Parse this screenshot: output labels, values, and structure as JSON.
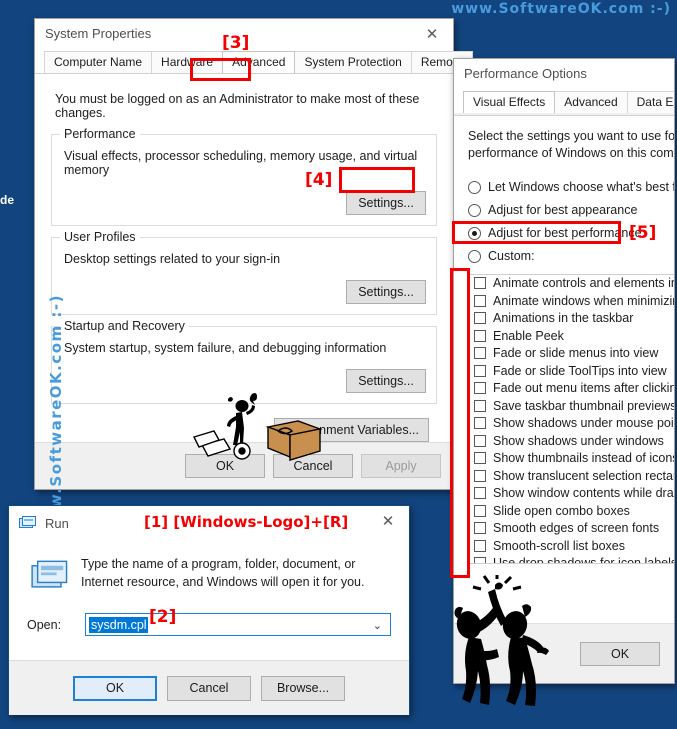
{
  "watermark": {
    "top": "www.SoftwareOK.com  :-)",
    "vertical": "www.SoftwareOK.com  :-)",
    "fragment": "de"
  },
  "system_properties": {
    "title": "System Properties",
    "close_icon": "✕",
    "tabs": [
      {
        "label": "Computer Name",
        "active": false
      },
      {
        "label": "Hardware",
        "active": false
      },
      {
        "label": "Advanced",
        "active": true
      },
      {
        "label": "System Protection",
        "active": false
      },
      {
        "label": "Remote",
        "active": false
      }
    ],
    "intro": "You must be logged on as an Administrator to make most of these changes.",
    "groups": [
      {
        "legend": "Performance",
        "text": "Visual effects, processor scheduling, memory usage, and virtual memory",
        "button": "Settings..."
      },
      {
        "legend": "User Profiles",
        "text": "Desktop settings related to your sign-in",
        "button": "Settings..."
      },
      {
        "legend": "Startup and Recovery",
        "text": "System startup, system failure, and debugging information",
        "button": "Settings..."
      }
    ],
    "environment_button": "Environment Variables...",
    "footer": {
      "ok": "OK",
      "cancel": "Cancel",
      "apply": "Apply"
    }
  },
  "performance_options": {
    "title": "Performance Options",
    "tabs": [
      {
        "label": "Visual Effects",
        "active": true
      },
      {
        "label": "Advanced",
        "active": false
      },
      {
        "label": "Data Execution Prevention",
        "active": false
      }
    ],
    "description": "Select the settings you want to use for the appearance and performance of Windows on this computer.",
    "radios": [
      {
        "label": "Let Windows choose what's best for my computer",
        "selected": false
      },
      {
        "label": "Adjust for best appearance",
        "selected": false
      },
      {
        "label": "Adjust for best performance",
        "selected": true
      },
      {
        "label": "Custom:",
        "selected": false
      }
    ],
    "effects": [
      {
        "label": "Animate controls and elements inside windows",
        "checked": false
      },
      {
        "label": "Animate windows when minimizing and maximizing",
        "checked": false
      },
      {
        "label": "Animations in the taskbar",
        "checked": false
      },
      {
        "label": "Enable Peek",
        "checked": false
      },
      {
        "label": "Fade or slide menus into view",
        "checked": false
      },
      {
        "label": "Fade or slide ToolTips into view",
        "checked": false
      },
      {
        "label": "Fade out menu items after clicking",
        "checked": false
      },
      {
        "label": "Save taskbar thumbnail previews",
        "checked": false
      },
      {
        "label": "Show shadows under mouse pointer",
        "checked": false
      },
      {
        "label": "Show shadows under windows",
        "checked": false
      },
      {
        "label": "Show thumbnails instead of icons",
        "checked": false
      },
      {
        "label": "Show translucent selection rectangle",
        "checked": false
      },
      {
        "label": "Show window contents while dragging",
        "checked": false
      },
      {
        "label": "Slide open combo boxes",
        "checked": false
      },
      {
        "label": "Smooth edges of screen fonts",
        "checked": false
      },
      {
        "label": "Smooth-scroll list boxes",
        "checked": false
      },
      {
        "label": "Use drop shadows for icon labels on the desktop",
        "checked": false
      }
    ],
    "footer": {
      "ok": "OK"
    }
  },
  "run_dialog": {
    "title": "Run",
    "close_icon": "✕",
    "header_note": "[1] [Windows-Logo]+[R]",
    "description": "Type the name of a program, folder, document, or Internet resource, and Windows will open it for you.",
    "open_label": "Open:",
    "open_value": "sysdm.cpl",
    "caret_icon": "⌄",
    "footer": {
      "ok": "OK",
      "cancel": "Cancel",
      "browse": "Browse..."
    }
  },
  "annotations": {
    "step3": "[3]",
    "step4": "[4]",
    "step5": "[5]",
    "step2": "[2]"
  },
  "colors": {
    "background": "#12457f",
    "annotation_red": "#f50000",
    "watermark_blue": "#4a9bdc",
    "accent_blue": "#1d7fd8",
    "selection_blue": "#0078d7"
  }
}
